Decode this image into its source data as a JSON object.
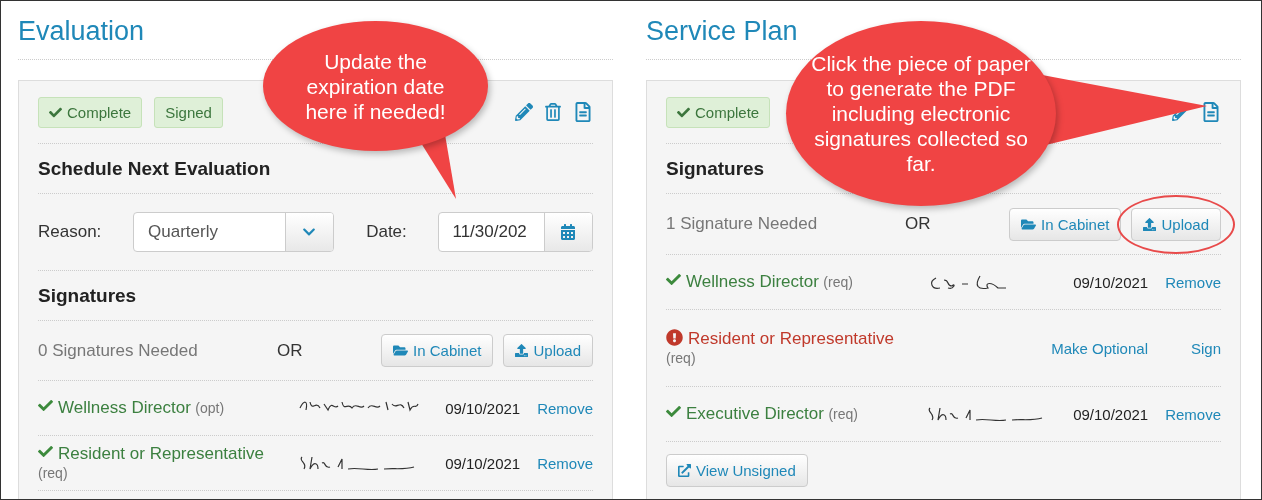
{
  "panels": [
    {
      "title": "Evaluation",
      "badges": [
        {
          "label": "Complete",
          "kind": "check"
        },
        {
          "label": "Signed",
          "kind": "plain"
        }
      ],
      "actions": [
        {
          "kind": "edit"
        },
        {
          "kind": "delete"
        },
        {
          "kind": "document"
        }
      ],
      "schedule": {
        "heading": "Schedule Next Evaluation",
        "reason_label": "Reason:",
        "reason_value": "Quarterly",
        "date_label": "Date:",
        "date_value": "11/30/202"
      },
      "signatures": {
        "heading": "Signatures",
        "needed": "0 Signatures Needed",
        "or": "OR",
        "buttons": [
          {
            "label": "In Cabinet",
            "kind": "cabinet",
            "circled": false
          },
          {
            "label": "Upload",
            "kind": "upload",
            "circled": false
          }
        ],
        "rows": [
          {
            "role": "Wellness Director",
            "note": "(opt)",
            "signed": true,
            "date": "09/10/2021",
            "links": [
              "Remove"
            ]
          },
          {
            "role": "Resident or Representative",
            "note": "(req)",
            "signed": true,
            "date": "09/10/2021",
            "links": [
              "Remove"
            ]
          }
        ]
      }
    },
    {
      "title": "Service Plan",
      "badges": [
        {
          "label": "Complete",
          "kind": "check"
        }
      ],
      "actions": [
        {
          "kind": "edit"
        },
        {
          "kind": "document"
        }
      ],
      "signatures": {
        "heading": "Signatures",
        "needed": "1 Signature Needed",
        "or": "OR",
        "buttons": [
          {
            "label": "In Cabinet",
            "kind": "cabinet",
            "circled": false
          },
          {
            "label": "Upload",
            "kind": "upload",
            "circled": true
          }
        ],
        "rows": [
          {
            "role": "Wellness Director",
            "note": "(req)",
            "signed": true,
            "date": "09/10/2021",
            "links": [
              "Remove"
            ]
          },
          {
            "role": "Resident or Representative",
            "note": "(req)",
            "signed": false,
            "links": [
              "Make Optional",
              "Sign"
            ]
          },
          {
            "role": "Executive Director",
            "note": "(req)",
            "signed": true,
            "date": "09/10/2021",
            "links": [
              "Remove"
            ]
          }
        ],
        "footer_button": "View Unsigned"
      }
    }
  ],
  "callouts": [
    {
      "text": "Update the expiration date here if needed!"
    },
    {
      "text": "Click the piece of paper to generate the PDF including electronic signatures collected so far."
    }
  ]
}
